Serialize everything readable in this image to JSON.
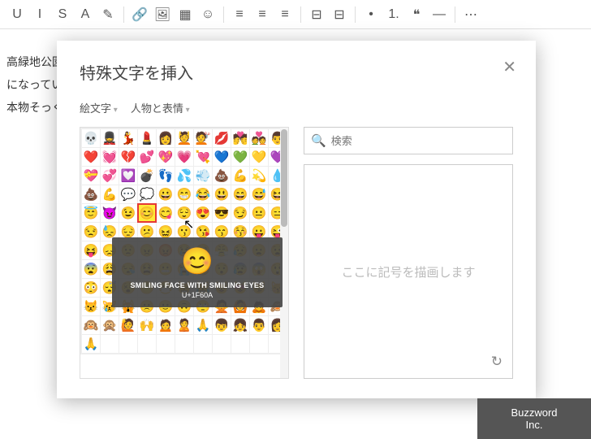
{
  "toolbar_icons": [
    "U",
    "I",
    "S",
    "A",
    "✎",
    "|",
    "🔗",
    "🖼",
    "▦",
    "☺",
    "|",
    "≡",
    "≡",
    "≡",
    "|",
    "⊟",
    "⊟",
    "|",
    "•",
    "1.",
    "❝",
    "—",
    "|",
    "⋯"
  ],
  "doc_lines": [
    "高緑地公園",
    "になってい",
    "本物そっく"
  ],
  "modal": {
    "title": "特殊文字を挿入",
    "selector1": "絵文字",
    "selector2": "人物と表情",
    "search_placeholder": "検索",
    "draw_hint": "ここに記号を描画します"
  },
  "tooltip": {
    "emoji": "😊",
    "name": "SMILING FACE WITH SMILING EYES",
    "code": "U+1F60A"
  },
  "emoji_rows": [
    [
      "💀",
      "💂",
      "💃",
      "💄",
      "👩",
      "💆",
      "💇",
      "💋",
      "💏",
      "💑",
      "👨"
    ],
    [
      "❤️",
      "💓",
      "💔",
      "💕",
      "💖",
      "💗",
      "💘",
      "💙",
      "💚",
      "💛",
      "💜"
    ],
    [
      "💝",
      "💞",
      "💟",
      "💣",
      "👣",
      "💦",
      "💨",
      "💩",
      "💪",
      "💫",
      "💧"
    ],
    [
      "💩",
      "💪",
      "💬",
      "💭",
      "😀",
      "😁",
      "😂",
      "😃",
      "😄",
      "😅",
      "😆"
    ],
    [
      "😇",
      "😈",
      "😉",
      "😊",
      "😋",
      "😌",
      "😍",
      "😎",
      "😏",
      "😐",
      "😑"
    ],
    [
      "😒",
      "😓",
      "😔",
      "😕",
      "😖",
      "😗",
      "😘",
      "😙",
      "😚",
      "😛",
      "😜"
    ],
    [
      "😝",
      "😞",
      "😟",
      "😠",
      "😡",
      "😢",
      "😣",
      "😤",
      "😥",
      "😦",
      "😧"
    ],
    [
      "😨",
      "😩",
      "😪",
      "😫",
      "😬",
      "😭",
      "😮",
      "😯",
      "😰",
      "😱",
      "😲"
    ],
    [
      "😳",
      "😴",
      "😵",
      "😶",
      "😷",
      "😸",
      "😹",
      "😺",
      "😻",
      "😼",
      "😽"
    ],
    [
      "😾",
      "😿",
      "🙀",
      "🙁",
      "🙂",
      "🙃",
      "🙄",
      "🙅",
      "🙆",
      "🙇",
      "🙈"
    ],
    [
      "🙉",
      "🙊",
      "🙋",
      "🙌",
      "🙍",
      "🙎",
      "🙏",
      "👦",
      "👧",
      "👨",
      "👩"
    ],
    [
      "🙏",
      "",
      "",
      "",
      "",
      "",
      "",
      "",
      "",
      "",
      ""
    ]
  ],
  "selected": {
    "row": 4,
    "col": 3
  },
  "brand": "Buzzword Inc."
}
